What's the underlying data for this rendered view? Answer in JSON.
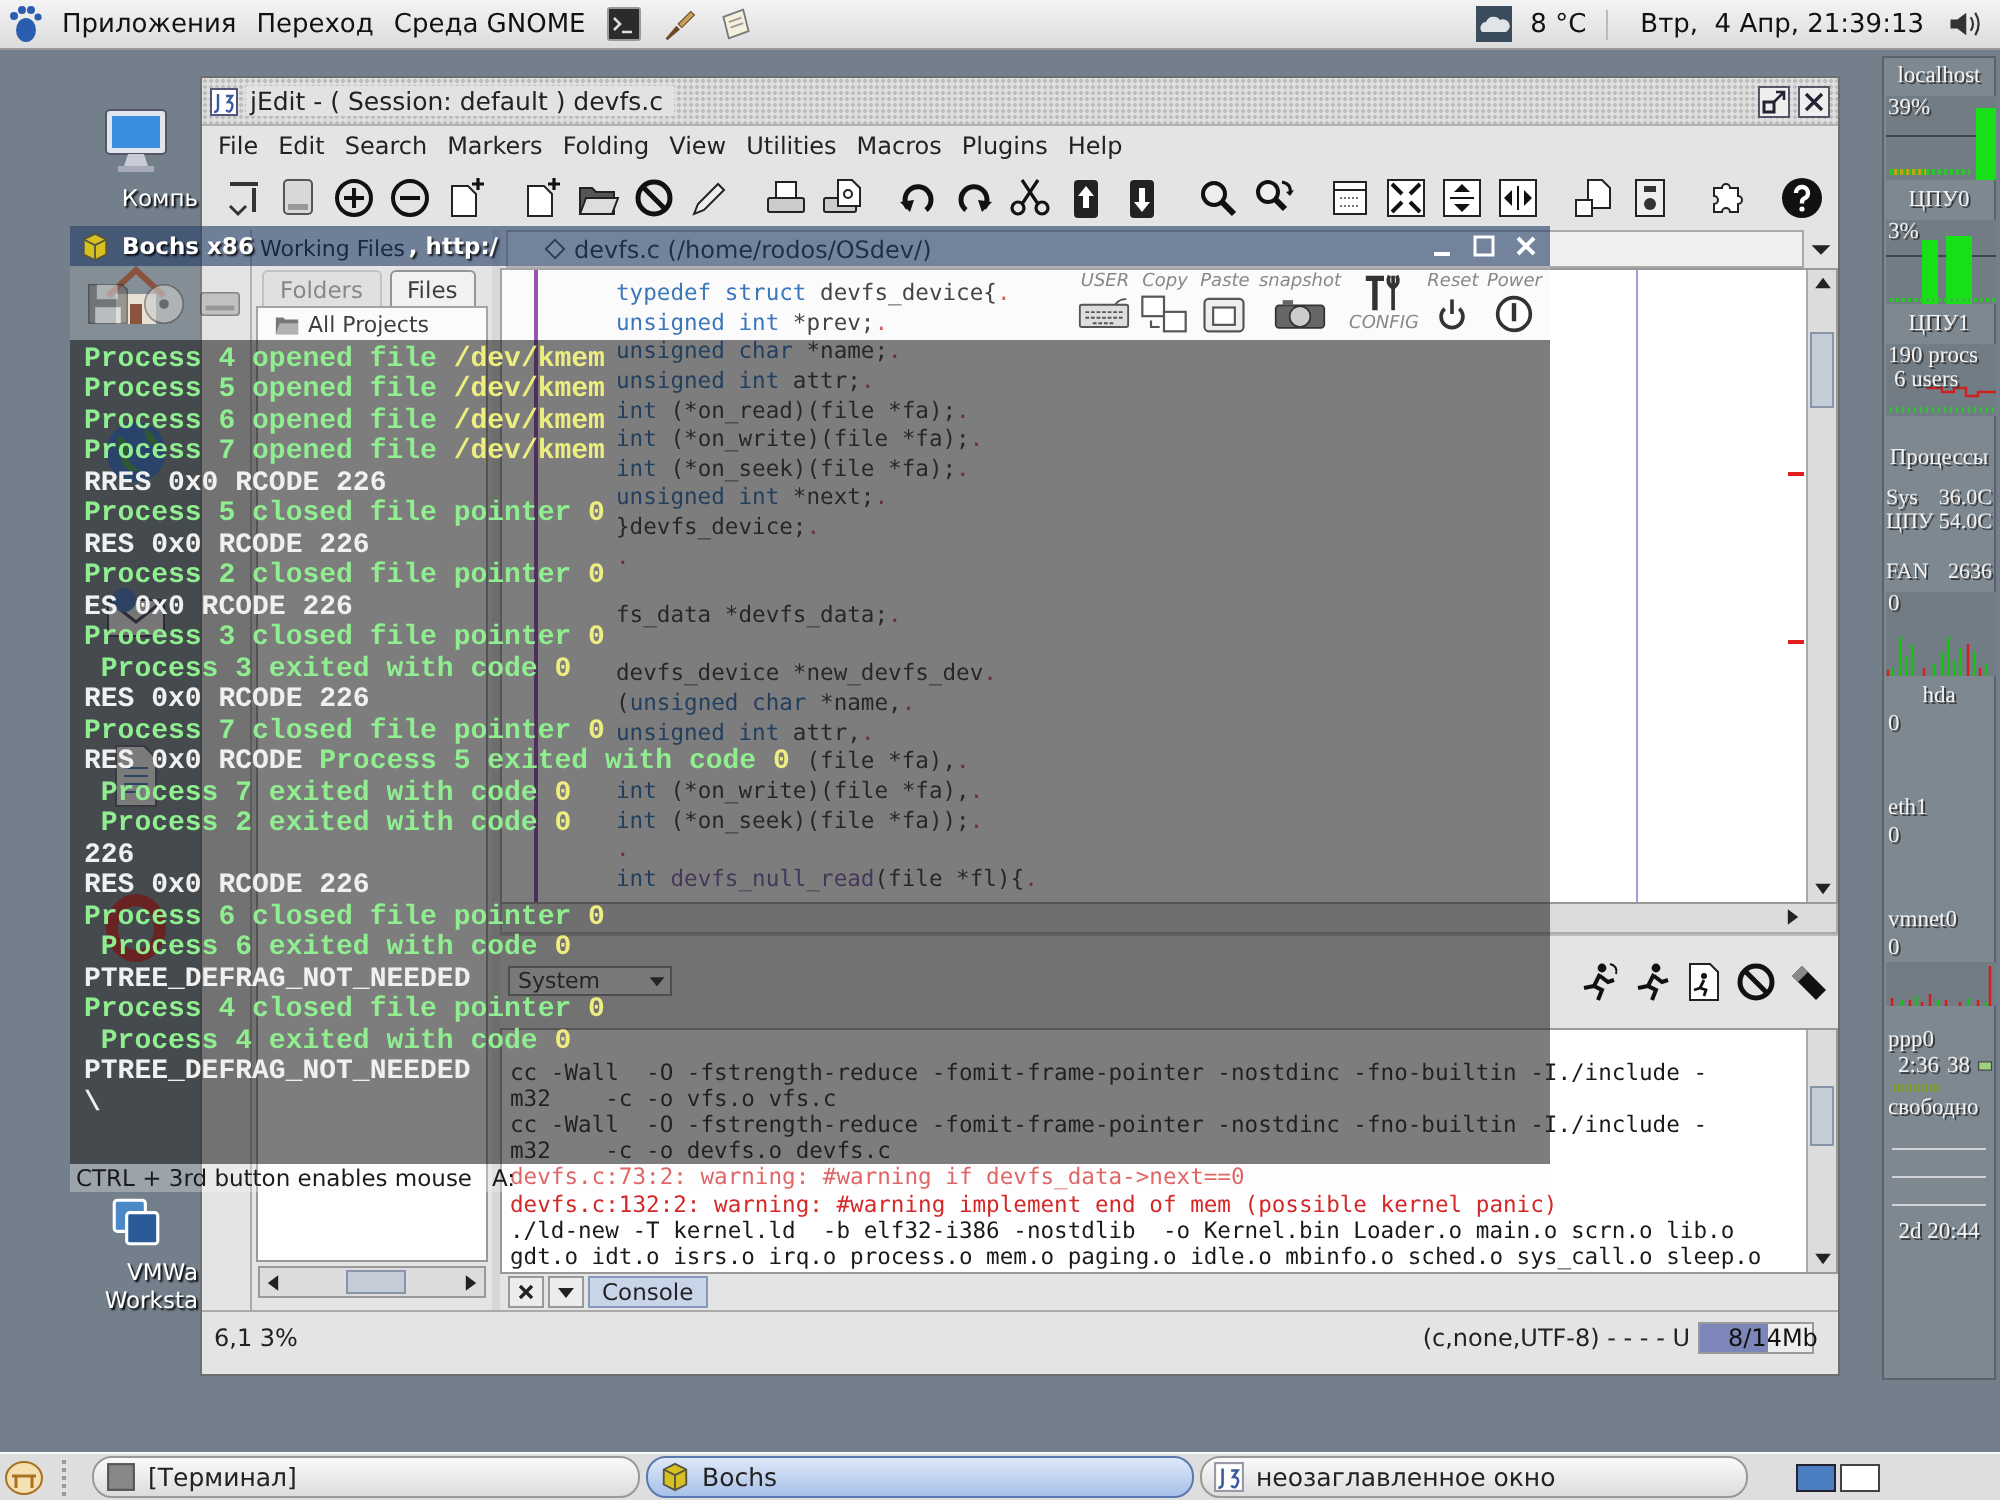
{
  "top_panel": {
    "menus": [
      "Приложения",
      "Переход",
      "Среда GNOME"
    ],
    "weather": "8 °C",
    "clock": "Втр,  4 Апр, 21:39:13"
  },
  "desktop_icons": [
    {
      "kind": "computer",
      "label": "Компь"
    },
    {
      "kind": "home"
    },
    {
      "kind": "globe"
    },
    {
      "kind": "mail"
    },
    {
      "kind": "writer"
    },
    {
      "kind": "opera"
    },
    {
      "kind": "vmware",
      "label": "VMWa\nWorksta"
    }
  ],
  "jedit": {
    "title": "jEdit - ( Session: default ) devfs.c",
    "menu": [
      "File",
      "Edit",
      "Search",
      "Markers",
      "Folding",
      "View",
      "Utilities",
      "Macros",
      "Plugins",
      "Help"
    ],
    "project": {
      "header": "Working Files",
      "tabs": [
        {
          "label": "Folders",
          "selected": false
        },
        {
          "label": "Files",
          "selected": true
        }
      ],
      "root": "All Projects"
    },
    "buffer": {
      "title": "devfs.c (/home/rodos/OSdev/)",
      "lines": [
        {
          "kind": "code",
          "parts": [
            {
              "kind": "keyword",
              "text": "typedef struct "
            },
            {
              "kind": "plain",
              "text": "devfs_device{"
            },
            {
              "kind": "eol",
              "text": "."
            }
          ]
        },
        {
          "kind": "code",
          "parts": [
            {
              "kind": "keyword",
              "text": "unsigned int "
            },
            {
              "kind": "plain",
              "text": "*prev;"
            },
            {
              "kind": "eol",
              "text": "."
            }
          ]
        },
        {
          "kind": "code",
          "parts": [
            {
              "kind": "keyword",
              "text": "unsigned char "
            },
            {
              "kind": "plain",
              "text": "*name;"
            },
            {
              "kind": "eol",
              "text": "."
            }
          ]
        },
        {
          "kind": "code",
          "parts": [
            {
              "kind": "keyword",
              "text": "unsigned int "
            },
            {
              "kind": "plain",
              "text": "attr;"
            },
            {
              "kind": "eol",
              "text": "."
            }
          ]
        },
        {
          "kind": "code",
          "parts": [
            {
              "kind": "keyword",
              "text": "int "
            },
            {
              "kind": "plain",
              "text": "(*on_read)(file *fa);"
            },
            {
              "kind": "eol",
              "text": "."
            }
          ]
        },
        {
          "kind": "code",
          "parts": [
            {
              "kind": "keyword",
              "text": "int "
            },
            {
              "kind": "plain",
              "text": "(*on_write)(file *fa);"
            },
            {
              "kind": "eol",
              "text": "."
            }
          ]
        },
        {
          "kind": "code",
          "parts": [
            {
              "kind": "keyword",
              "text": "int "
            },
            {
              "kind": "plain",
              "text": "(*on_seek)(file *fa);"
            },
            {
              "kind": "eol",
              "text": "."
            }
          ]
        },
        {
          "kind": "code",
          "parts": [
            {
              "kind": "keyword",
              "text": "unsigned int "
            },
            {
              "kind": "plain",
              "text": "*next;"
            },
            {
              "kind": "eol",
              "text": "."
            }
          ]
        },
        {
          "kind": "code",
          "parts": [
            {
              "kind": "plain",
              "text": "}devfs_device;"
            },
            {
              "kind": "eol",
              "text": "."
            }
          ]
        },
        {
          "kind": "code",
          "parts": [
            {
              "kind": "eol",
              "text": "."
            }
          ]
        },
        {
          "kind": "blank"
        },
        {
          "kind": "code",
          "parts": [
            {
              "kind": "plain",
              "text": "fs_data *devfs_data;"
            },
            {
              "kind": "eol",
              "text": "."
            }
          ]
        },
        {
          "kind": "blank"
        },
        {
          "kind": "code",
          "parts": [
            {
              "kind": "plain",
              "text": "devfs_device *new_devfs_dev"
            },
            {
              "kind": "eol",
              "text": "."
            }
          ]
        },
        {
          "kind": "code",
          "parts": [
            {
              "kind": "plain",
              "text": "("
            },
            {
              "kind": "keyword",
              "text": "unsigned char "
            },
            {
              "kind": "plain",
              "text": "*name,"
            },
            {
              "kind": "eol",
              "text": "."
            }
          ]
        },
        {
          "kind": "code",
          "parts": [
            {
              "kind": "keyword",
              "text": "unsigned int "
            },
            {
              "kind": "plain",
              "text": "attr,"
            },
            {
              "kind": "eol",
              "text": "."
            }
          ]
        },
        {
          "kind": "tail",
          "parts": [
            {
              "kind": "plain",
              "text": "(file *fa),"
            },
            {
              "kind": "eol",
              "text": "."
            }
          ]
        },
        {
          "kind": "code",
          "parts": [
            {
              "kind": "keyword",
              "text": "int "
            },
            {
              "kind": "plain",
              "text": "(*on_write)(file *fa),"
            },
            {
              "kind": "eol",
              "text": "."
            }
          ]
        },
        {
          "kind": "code",
          "parts": [
            {
              "kind": "keyword",
              "text": "int "
            },
            {
              "kind": "plain",
              "text": "(*on_seek)(file *fa));"
            },
            {
              "kind": "eol",
              "text": "."
            }
          ]
        },
        {
          "kind": "code",
          "parts": [
            {
              "kind": "eol",
              "text": "."
            }
          ]
        },
        {
          "kind": "code",
          "parts": [
            {
              "kind": "keyword",
              "text": "int "
            },
            {
              "kind": "function",
              "text": "devfs_null_read"
            },
            {
              "kind": "plain",
              "text": "(file *fl){"
            },
            {
              "kind": "eol",
              "text": "."
            }
          ]
        }
      ]
    },
    "console": {
      "shell": "System",
      "lines": [
        {
          "kind": "output",
          "text": "cc -Wall  -O -fstrength-reduce -fomit-frame-pointer -nostdinc -fno-builtin -I./include -"
        },
        {
          "kind": "output",
          "text": "m32    -c -o vfs.o vfs.c"
        },
        {
          "kind": "output",
          "text": "cc -Wall  -O -fstrength-reduce -fomit-frame-pointer -nostdinc -fno-builtin -I./include -"
        },
        {
          "kind": "output",
          "text": "m32    -c -o devfs.o devfs.c"
        },
        {
          "kind": "warning",
          "text": "devfs.c:73:2: warning: #warning if devfs_data->next==0"
        },
        {
          "kind": "warning",
          "text": "devfs.c:132:2: warning: #warning implement end of mem (possible kernel panic)"
        },
        {
          "kind": "output",
          "text": "./ld-new -T kernel.ld  -b elf32-i386 -nostdlib  -o Kernel.bin Loader.o main.o scrn.o lib.o"
        },
        {
          "kind": "output",
          "text": "gdt.o idt.o isrs.o irq.o process.o mem.o paging.o idle.o mbinfo.o sched.o sys_call.o sleep.o"
        }
      ],
      "tab": "Console"
    },
    "status": {
      "position": "6,1 3%",
      "mode": "(c,none,UTF-8) - - - - U",
      "memory": {
        "reading": "8/14Mb",
        "level": 0.6
      }
    }
  },
  "bochs": {
    "title": [
      "Bochs x86",
      ", http:/"
    ],
    "toolbar": [
      {
        "kind": "keyboard",
        "label": "USER"
      },
      {
        "kind": "copy",
        "label": "Copy"
      },
      {
        "kind": "paste",
        "label": "Paste"
      },
      {
        "kind": "snapshot",
        "label": "snapshot"
      },
      {
        "kind": "config",
        "label": "CONFIG"
      },
      {
        "kind": "reset",
        "label": "Reset"
      },
      {
        "kind": "power",
        "label": "Power"
      }
    ],
    "console": [
      {
        "parts": [
          {
            "text": "Process 4 opened file ",
            "color": "#90ee90"
          },
          {
            "text": "/dev/kmem",
            "color": "#eeee80"
          }
        ]
      },
      {
        "parts": [
          {
            "text": "Process 5 opened file ",
            "color": "#90ee90"
          },
          {
            "text": "/dev/kmem",
            "color": "#eeee80"
          }
        ]
      },
      {
        "parts": [
          {
            "text": "Process 6 opened file ",
            "color": "#90ee90"
          },
          {
            "text": "/dev/kmem",
            "color": "#eeee80"
          }
        ]
      },
      {
        "parts": [
          {
            "text": "Process 7 opened file ",
            "color": "#90ee90"
          },
          {
            "text": "/dev/kmem",
            "color": "#eeee80"
          }
        ]
      },
      {
        "parts": [
          {
            "text": "RRES 0x0 RCODE 226",
            "color": "#f0f0f0"
          }
        ]
      },
      {
        "parts": [
          {
            "text": "Process 5 closed file pointer ",
            "color": "#90ee90"
          },
          {
            "text": "0",
            "color": "#eeee80"
          }
        ]
      },
      {
        "parts": [
          {
            "text": "RES 0x0 RCODE 226",
            "color": "#f0f0f0"
          }
        ]
      },
      {
        "parts": [
          {
            "text": "Process 2 closed file pointer ",
            "color": "#90ee90"
          },
          {
            "text": "0",
            "color": "#eeee80"
          }
        ]
      },
      {
        "parts": [
          {
            "text": "ES 0x0 RCODE 226",
            "color": "#f0f0f0"
          }
        ]
      },
      {
        "parts": [
          {
            "text": "Process 3 closed file pointer ",
            "color": "#90ee90"
          },
          {
            "text": "0",
            "color": "#eeee80"
          }
        ]
      },
      {
        "parts": [
          {
            "text": " Process 3 exited with code ",
            "color": "#90ee90"
          },
          {
            "text": "0",
            "color": "#eeee80"
          }
        ]
      },
      {
        "parts": [
          {
            "text": "RES 0x0 RCODE 226",
            "color": "#f0f0f0"
          }
        ]
      },
      {
        "parts": [
          {
            "text": "Process 7 closed file pointer ",
            "color": "#90ee90"
          },
          {
            "text": "0",
            "color": "#eeee80"
          }
        ]
      },
      {
        "parts": [
          {
            "text": "RES 0x0 RCODE ",
            "color": "#f0f0f0"
          },
          {
            "text": "Process 5 exited with code ",
            "color": "#90ee90"
          },
          {
            "text": "0",
            "color": "#eeee80"
          }
        ]
      },
      {
        "parts": [
          {
            "text": " Process 7 exited with code ",
            "color": "#90ee90"
          },
          {
            "text": "0",
            "color": "#eeee80"
          }
        ]
      },
      {
        "parts": [
          {
            "text": " Process 2 exited with code ",
            "color": "#90ee90"
          },
          {
            "text": "0",
            "color": "#eeee80"
          }
        ]
      },
      {
        "parts": [
          {
            "text": "226",
            "color": "#f0f0f0"
          }
        ]
      },
      {
        "parts": [
          {
            "text": "RES 0x0 RCODE 226",
            "color": "#f0f0f0"
          }
        ]
      },
      {
        "parts": [
          {
            "text": "Process 6 closed file pointer ",
            "color": "#90ee90"
          },
          {
            "text": "0",
            "color": "#eeee80"
          }
        ]
      },
      {
        "parts": [
          {
            "text": " Process 6 exited with code ",
            "color": "#90ee90"
          },
          {
            "text": "0",
            "color": "#eeee80"
          }
        ]
      },
      {
        "parts": [
          {
            "text": "PTREE_DEFRAG_NOT_NEEDED",
            "color": "#f0f0f0"
          }
        ]
      },
      {
        "parts": [
          {
            "text": "Process 4 closed file pointer ",
            "color": "#90ee90"
          },
          {
            "text": "0",
            "color": "#eeee80"
          }
        ]
      },
      {
        "parts": [
          {
            "text": " Process 4 exited with code ",
            "color": "#90ee90"
          },
          {
            "text": "0",
            "color": "#eeee80"
          }
        ]
      },
      {
        "parts": [
          {
            "text": "PTREE_DEFRAG_NOT_NEEDED",
            "color": "#f0f0f0"
          }
        ]
      },
      {
        "parts": [
          {
            "text": "\\",
            "color": "#f0f0f0"
          }
        ]
      }
    ],
    "status": {
      "hint": "CTRL + 3rd button enables mouse",
      "drive": "A:"
    }
  },
  "monitor": {
    "host": "localhost",
    "cpu_total": "39%",
    "cpu0": {
      "label": "ЦПУ0",
      "reading": "3%"
    },
    "cpu1": {
      "label": "ЦПУ1"
    },
    "procs": "190 procs",
    "users": "6 users",
    "processes": "Процессы",
    "sensors": [
      {
        "label": "Sys",
        "value": "36.0C"
      },
      {
        "label": "ЦПУ",
        "value": "54.0C"
      }
    ],
    "fan": {
      "label": "FAN",
      "value": "2636",
      "reading": "0"
    },
    "disk": {
      "label": "hda",
      "reading": "0"
    },
    "eth": {
      "label": "eth1",
      "reading": "0"
    },
    "vmnet": {
      "label": "vmnet0",
      "reading": "0"
    },
    "ppp": {
      "label": "ppp0",
      "time": "2:36",
      "value": "38",
      "status": "свободно"
    },
    "uptime": "2d 20:44"
  },
  "taskbar": {
    "tasks": [
      {
        "kind": "terminal",
        "label": "[Терминал]",
        "selected": false
      },
      {
        "kind": "bochs",
        "label": "Bochs",
        "selected": true
      },
      {
        "kind": "editor",
        "label": "неозаглавленное окно",
        "selected": false
      }
    ],
    "workspaces": [
      {
        "selected": true
      },
      {
        "selected": false
      }
    ]
  }
}
